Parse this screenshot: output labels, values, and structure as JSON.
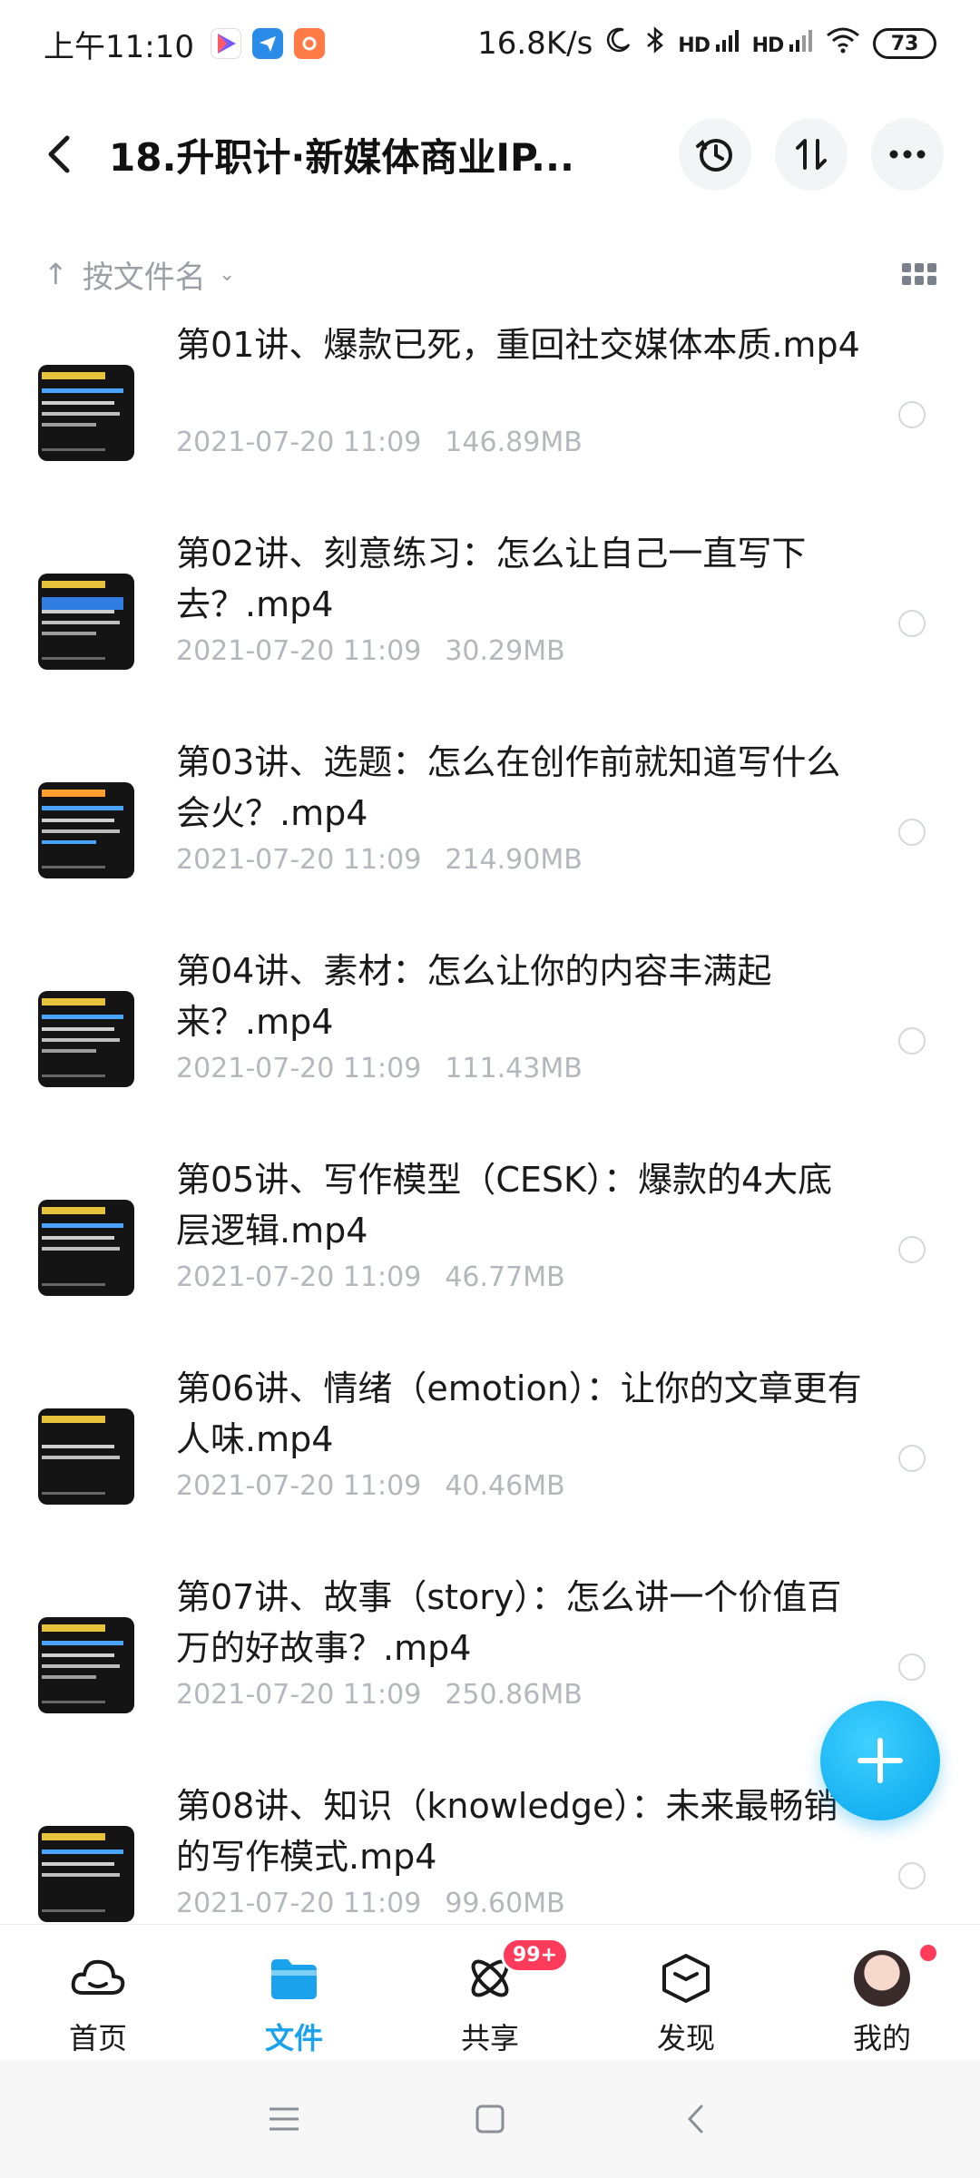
{
  "status_bar": {
    "time": "上午11:10",
    "network_speed": "16.8K/s",
    "signal1": "HD",
    "signal2": "HD",
    "battery": "73"
  },
  "header": {
    "title": "18.升职计·新媒体商业IP..."
  },
  "sort": {
    "label": "按文件名"
  },
  "files": [
    {
      "name": "第01讲、爆款已死，重回社交媒体本质.mp4",
      "date": "2021-07-20  11:09",
      "size": "146.89MB"
    },
    {
      "name": "第02讲、刻意练习：怎么让自己一直写下去？.mp4",
      "date": "2021-07-20  11:09",
      "size": "30.29MB"
    },
    {
      "name": "第03讲、选题：怎么在创作前就知道写什么会火？.mp4",
      "date": "2021-07-20  11:09",
      "size": "214.90MB"
    },
    {
      "name": "第04讲、素材：怎么让你的内容丰满起来？.mp4",
      "date": "2021-07-20  11:09",
      "size": "111.43MB"
    },
    {
      "name": "第05讲、写作模型（CESK）：爆款的4大底层逻辑.mp4",
      "date": "2021-07-20  11:09",
      "size": "46.77MB"
    },
    {
      "name": "第06讲、情绪（emotion）：让你的文章更有人味.mp4",
      "date": "2021-07-20  11:09",
      "size": "40.46MB"
    },
    {
      "name": "第07讲、故事（story）：怎么讲一个价值百万的好故事？.mp4",
      "date": "2021-07-20  11:09",
      "size": "250.86MB"
    },
    {
      "name": "第08讲、知识（knowledge）：未来最畅销的写作模式.mp4",
      "date": "2021-07-20  11:09",
      "size": "99.60MB"
    }
  ],
  "bottom_nav": [
    {
      "label": "首页",
      "icon": "cloud-icon"
    },
    {
      "label": "文件",
      "icon": "folder-icon"
    },
    {
      "label": "共享",
      "icon": "atom-icon",
      "badge": "99+"
    },
    {
      "label": "发现",
      "icon": "hexagon-icon"
    },
    {
      "label": "我的",
      "icon": "avatar"
    }
  ],
  "colors": {
    "accent": "#1aa3ec",
    "badge": "#ff3b5c",
    "meta_text": "#b4b8bd"
  }
}
